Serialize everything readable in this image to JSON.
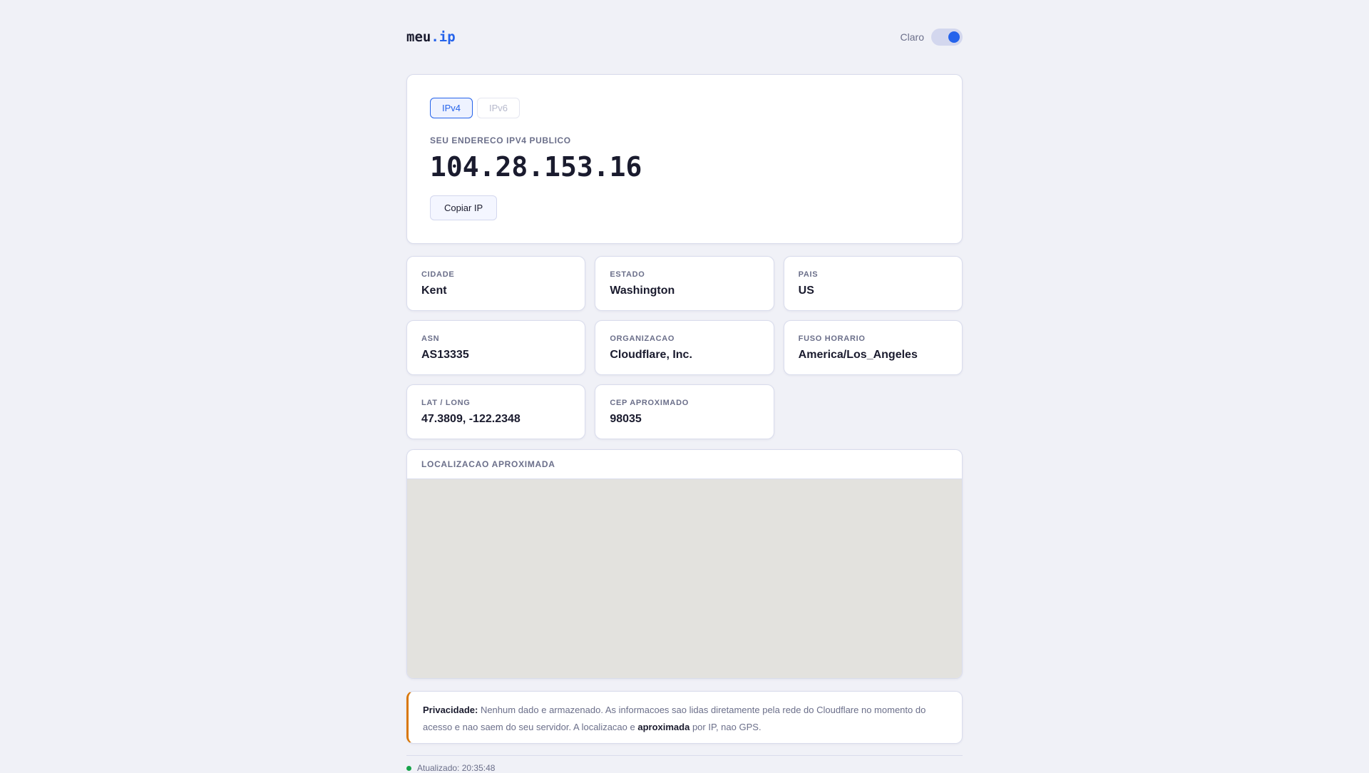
{
  "header": {
    "logo_main": "meu",
    "logo_accent": ".ip",
    "theme_label": "Claro",
    "theme_dark": true
  },
  "main": {
    "tabs": [
      {
        "label": "IPv4",
        "active": true
      },
      {
        "label": "IPv6",
        "active": false
      }
    ],
    "label": "SEU ENDERECO IPV4 PUBLICO",
    "ip": "104.28.153.16",
    "copy_label": "Copiar IP"
  },
  "info": [
    {
      "label": "CIDADE",
      "value": "Kent"
    },
    {
      "label": "ESTADO",
      "value": "Washington"
    },
    {
      "label": "PAIS",
      "value": "US"
    },
    {
      "label": "ASN",
      "value": "AS13335"
    },
    {
      "label": "ORGANIZACAO",
      "value": "Cloudflare, Inc."
    },
    {
      "label": "FUSO HORARIO",
      "value": "America/Los_Angeles"
    },
    {
      "label": "LAT / LONG",
      "value": "47.3809, -122.2348"
    },
    {
      "label": "CEP APROXIMADO",
      "value": "98035"
    }
  ],
  "map": {
    "title": "LOCALIZACAO APROXIMADA"
  },
  "privacy": {
    "title": "Privacidade:",
    "text1": " Nenhum dado e armazenado. As informacoes sao lidas diretamente pela rede do Cloudflare no momento do acesso e nao saem do seu servidor. A localizacao e ",
    "bold": "aproximada",
    "text2": " por IP, nao GPS."
  },
  "footer": {
    "updated": "Atualizado: 20:35:48"
  }
}
